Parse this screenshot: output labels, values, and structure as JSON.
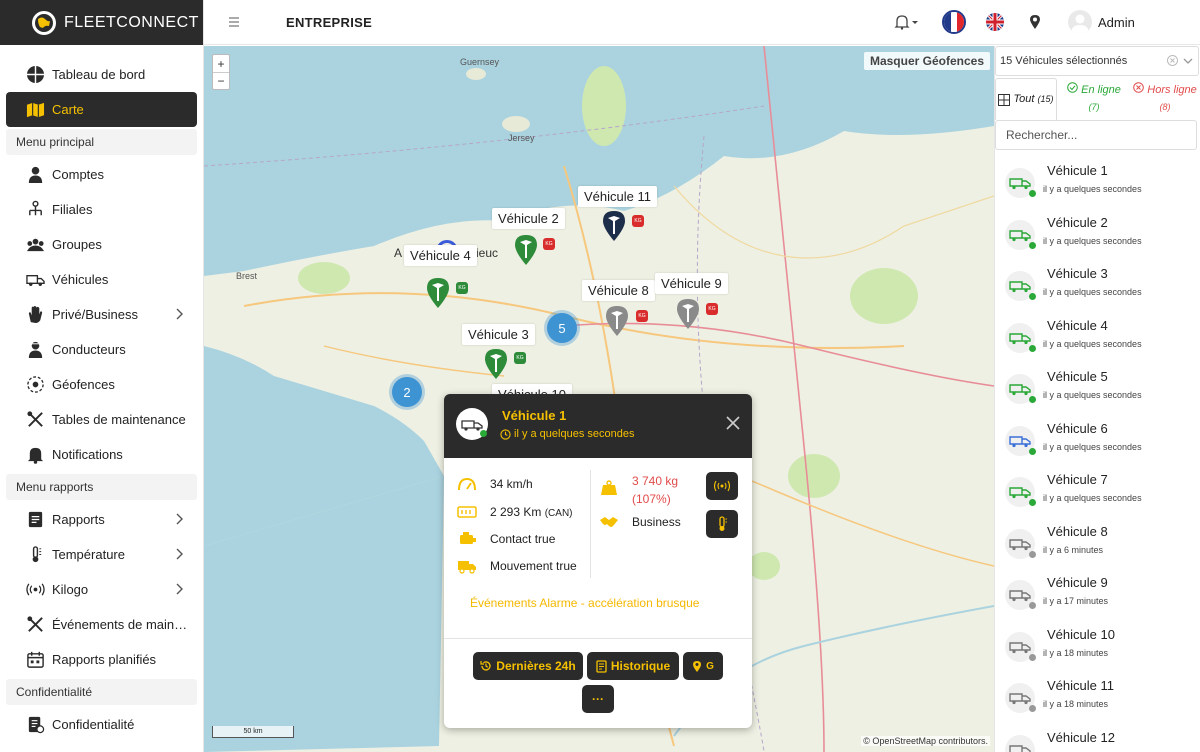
{
  "app": {
    "brand": "FLEETCONNECT"
  },
  "header": {
    "org": "ENTREPRISE",
    "user": "Admin"
  },
  "sidebar": {
    "top_items": [
      {
        "label": "Tableau de bord"
      },
      {
        "label": "Carte"
      }
    ],
    "sections": [
      {
        "title": "Menu principal",
        "items": [
          {
            "label": "Comptes"
          },
          {
            "label": "Filiales"
          },
          {
            "label": "Groupes"
          },
          {
            "label": "Véhicules"
          },
          {
            "label": "Privé/Business"
          },
          {
            "label": "Conducteurs"
          },
          {
            "label": "Géofences"
          },
          {
            "label": "Tables de maintenance"
          },
          {
            "label": "Notifications"
          }
        ]
      },
      {
        "title": "Menu rapports",
        "items": [
          {
            "label": "Rapports"
          },
          {
            "label": "Température"
          },
          {
            "label": "Kilogo"
          },
          {
            "label": "Événements de maintenance"
          },
          {
            "label": "Rapports planifiés"
          }
        ]
      },
      {
        "title": "Confidentialité",
        "items": [
          {
            "label": "Confidentialité"
          }
        ]
      }
    ]
  },
  "map": {
    "hide_geofences": "Masquer Géofences",
    "zoom_in": "+",
    "zoom_out": "−",
    "scale": "50 km",
    "attribution": "© OpenStreetMap contributors.",
    "vehicle_labels": [
      "Véhicule 2",
      "Véhicule 11",
      "Véhicule 4",
      "Véhicule 8",
      "Véhicule 9",
      "Véhicule 3",
      "Véhicule 10"
    ],
    "clusters": [
      "5",
      "2"
    ],
    "place_labels": {
      "guernsey": "Guernsey",
      "jersey": "Jersey",
      "brest": "Brest",
      "a": "A",
      "ieuc": "ieuc"
    }
  },
  "popup": {
    "title": "Véhicule 1",
    "time": "il y a quelques secondes",
    "speed": "34 km/h",
    "distance": "2 293 Km",
    "distance_src": "(CAN)",
    "contact": "Contact true",
    "movement": "Mouvement true",
    "weight": "3 740 kg",
    "weight_pct": "(107%)",
    "usage": "Business",
    "alarm": "Événements Alarme - accélération brusque",
    "btn_24h": "Dernières 24h",
    "btn_history": "Historique",
    "btn_geo": "G",
    "btn_more": "···"
  },
  "panel": {
    "select_label": "15 Véhicules sélectionnés",
    "tab_all": "Tout",
    "tab_all_count": "(15)",
    "tab_online": "En ligne",
    "tab_online_count": "(7)",
    "tab_offline": "Hors ligne",
    "tab_offline_count": "(8)",
    "search_placeholder": "Rechercher...",
    "vehicles": [
      {
        "name": "Véhicule 1",
        "time": "il y a quelques secondes"
      },
      {
        "name": "Véhicule 2",
        "time": "il y a quelques secondes"
      },
      {
        "name": "Véhicule 3",
        "time": "il y a quelques secondes"
      },
      {
        "name": "Véhicule 4",
        "time": "il y a quelques secondes"
      },
      {
        "name": "Véhicule 5",
        "time": "il y a quelques secondes"
      },
      {
        "name": "Véhicule 6",
        "time": "il y a quelques secondes"
      },
      {
        "name": "Véhicule 7",
        "time": "il y a quelques secondes"
      },
      {
        "name": "Véhicule 8",
        "time": "il y a 6 minutes"
      },
      {
        "name": "Véhicule 9",
        "time": "il y a 17 minutes"
      },
      {
        "name": "Véhicule 10",
        "time": "il y a 18 minutes"
      },
      {
        "name": "Véhicule 11",
        "time": "il y a 18 minutes"
      },
      {
        "name": "Véhicule 12",
        "time": ""
      }
    ]
  },
  "colors": {
    "accent": "#f5c000",
    "dark": "#2b2b2b",
    "online": "#2aa838",
    "offline": "#e24b4b",
    "cluster": "#3e93d2",
    "sea": "#aad3df"
  }
}
